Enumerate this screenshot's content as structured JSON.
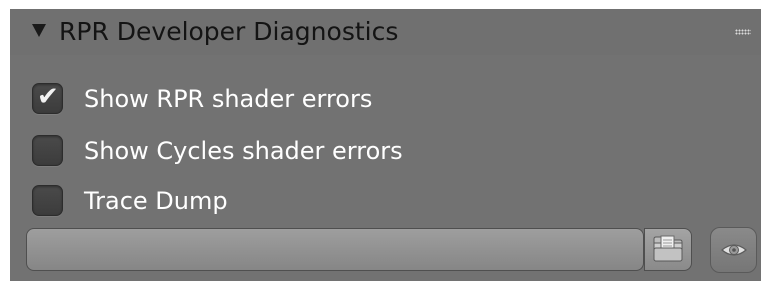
{
  "panel": {
    "title": "RPR Developer Diagnostics",
    "disclosure_icon": "triangle-down-icon",
    "grip_icon": "drag-grip-icon"
  },
  "options": [
    {
      "label": "Show RPR shader errors",
      "checked": true
    },
    {
      "label": "Show Cycles shader errors",
      "checked": false
    },
    {
      "label": "Trace Dump",
      "checked": false
    }
  ],
  "trace_path": {
    "value": "",
    "browse_icon": "folder-icon",
    "toggle_icon": "eye-icon"
  },
  "colors": {
    "panel_bg": "#727272",
    "checkbox_bg": "#444444",
    "text": "#ffffff",
    "header_text": "#141414"
  }
}
